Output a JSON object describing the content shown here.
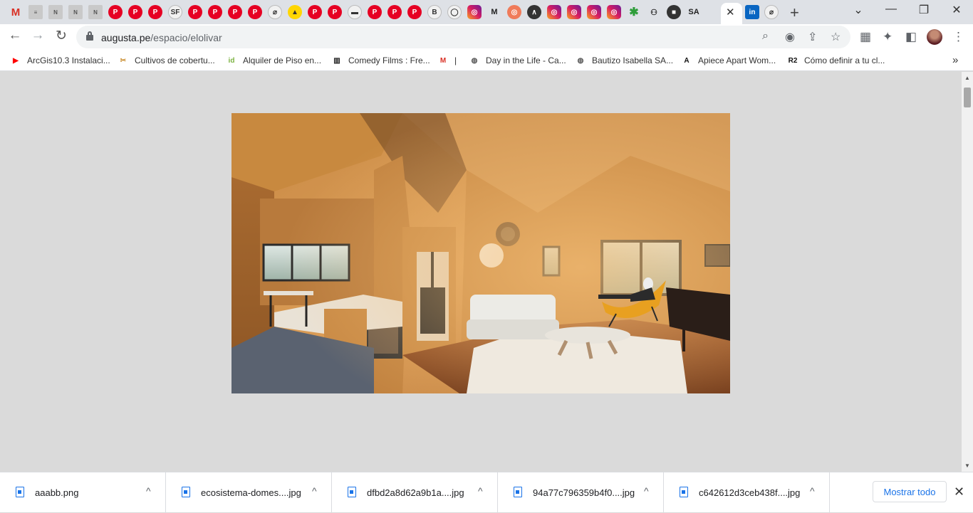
{
  "tabs": {
    "favicons": [
      {
        "name": "gmail-icon",
        "cls": "fav-gmail",
        "glyph": "M"
      },
      {
        "name": "doc-icon",
        "cls": "fav-doc",
        "glyph": "≡"
      },
      {
        "name": "nestle-icon",
        "cls": "fav-doc",
        "glyph": "N"
      },
      {
        "name": "nestle-icon",
        "cls": "fav-doc",
        "glyph": "N"
      },
      {
        "name": "nestle-icon",
        "cls": "fav-doc",
        "glyph": "N"
      },
      {
        "name": "pinterest-icon",
        "cls": "fav-pin",
        "glyph": "P"
      },
      {
        "name": "pinterest-icon",
        "cls": "fav-pin",
        "glyph": "P"
      },
      {
        "name": "pinterest-icon",
        "cls": "fav-pin",
        "glyph": "P"
      },
      {
        "name": "sf-icon",
        "cls": "fav-light",
        "glyph": "SF"
      },
      {
        "name": "pinterest-icon",
        "cls": "fav-pin",
        "glyph": "P"
      },
      {
        "name": "pinterest-icon",
        "cls": "fav-pin",
        "glyph": "P"
      },
      {
        "name": "pinterest-icon",
        "cls": "fav-pin",
        "glyph": "P"
      },
      {
        "name": "pinterest-icon",
        "cls": "fav-pin",
        "glyph": "P"
      },
      {
        "name": "clip-icon",
        "cls": "fav-light",
        "glyph": "⌀"
      },
      {
        "name": "yellow-app-icon",
        "cls": "fav-yellow",
        "glyph": "▲"
      },
      {
        "name": "pinterest-icon",
        "cls": "fav-pin",
        "glyph": "P"
      },
      {
        "name": "pinterest-icon",
        "cls": "fav-pin",
        "glyph": "P"
      },
      {
        "name": "film-icon",
        "cls": "fav-light",
        "glyph": "▬"
      },
      {
        "name": "pinterest-icon",
        "cls": "fav-pin",
        "glyph": "P"
      },
      {
        "name": "pinterest-icon",
        "cls": "fav-pin",
        "glyph": "P"
      },
      {
        "name": "pinterest-icon",
        "cls": "fav-pin",
        "glyph": "P"
      },
      {
        "name": "b-icon",
        "cls": "fav-light",
        "glyph": "B"
      },
      {
        "name": "circle-icon",
        "cls": "fav-light",
        "glyph": "◯"
      },
      {
        "name": "instagram-icon",
        "cls": "fav-ig",
        "glyph": "◎"
      },
      {
        "name": "medium-icon",
        "cls": "fav-text",
        "glyph": "M"
      },
      {
        "name": "target-icon",
        "cls": "fav-orange",
        "glyph": "◎"
      },
      {
        "name": "dark-app-icon",
        "cls": "fav-dark",
        "glyph": "∧"
      },
      {
        "name": "instagram-icon",
        "cls": "fav-ig",
        "glyph": "◎"
      },
      {
        "name": "instagram-icon",
        "cls": "fav-ig",
        "glyph": "◎"
      },
      {
        "name": "instagram-icon",
        "cls": "fav-ig",
        "glyph": "◎"
      },
      {
        "name": "instagram-icon",
        "cls": "fav-ig",
        "glyph": "◎"
      },
      {
        "name": "star-green-icon",
        "cls": "fav-green",
        "glyph": "✱"
      },
      {
        "name": "people-icon",
        "cls": "fav-text",
        "glyph": "⚇"
      },
      {
        "name": "cube-icon",
        "cls": "fav-dark",
        "glyph": "■"
      },
      {
        "name": "sa-icon",
        "cls": "fav-text",
        "glyph": "SA"
      }
    ],
    "after_active": [
      {
        "name": "linkedin-icon",
        "cls": "fav-li",
        "glyph": "in"
      },
      {
        "name": "clip-icon",
        "cls": "fav-light",
        "glyph": "⌀"
      }
    ],
    "close_glyph": "✕",
    "new_tab_glyph": "+"
  },
  "window": {
    "menu_glyph": "⌄",
    "minimize_glyph": "—",
    "restore_glyph": "❐",
    "close_glyph": "✕"
  },
  "toolbar": {
    "back_glyph": "←",
    "forward_glyph": "→",
    "reload_glyph": "↻",
    "url_host": "augusta.pe",
    "url_path": "/espacio/elolivar",
    "zoom_glyph": "⌕",
    "eye_glyph": "◉",
    "share_glyph": "⇪",
    "star_glyph": "☆",
    "grid_glyph": "▦",
    "ext_glyph": "✦",
    "panel_glyph": "◧",
    "more_glyph": "⋮"
  },
  "bookmarks": [
    {
      "label": "ArcGis10.3 Instalaci...",
      "icon": "▶",
      "color": "#ff0000",
      "name": "bookmark-arcgis",
      "icon_name": "youtube-icon"
    },
    {
      "label": "Cultivos de cobertu...",
      "icon": "✂",
      "color": "#c88a2a",
      "name": "bookmark-cultivos",
      "icon_name": "tools-icon"
    },
    {
      "label": "Alquiler de Piso en...",
      "icon": "id",
      "color": "#7cb342",
      "name": "bookmark-alquiler",
      "icon_name": "id-icon"
    },
    {
      "label": "Comedy Films : Fre...",
      "icon": "▥",
      "color": "#222222",
      "name": "bookmark-comedy",
      "icon_name": "archive-icon"
    },
    {
      "label": "|",
      "icon": "M",
      "color": "#d93025",
      "name": "bookmark-gmail",
      "icon_name": "gmail-icon"
    },
    {
      "label": "Day in the Life - Ca...",
      "icon": "◍",
      "color": "#555555",
      "name": "bookmark-day",
      "icon_name": "globe-icon"
    },
    {
      "label": "Bautizo Isabella SA...",
      "icon": "◍",
      "color": "#555555",
      "name": "bookmark-bautizo",
      "icon_name": "globe-icon"
    },
    {
      "label": "Apiece Apart Wom...",
      "icon": "A",
      "color": "#111111",
      "name": "bookmark-apiece",
      "icon_name": "a-icon"
    },
    {
      "label": "Cómo definir a tu cl...",
      "icon": "R2",
      "color": "#111111",
      "name": "bookmark-como",
      "icon_name": "r2-icon"
    }
  ],
  "bookmarks_more_glyph": "»",
  "downloads": {
    "items": [
      {
        "name": "aaabb.png"
      },
      {
        "name": "ecosistema-domes....jpg"
      },
      {
        "name": "dfbd2a8d62a9b1a....jpg"
      },
      {
        "name": "94a77c796359b4f0....jpg"
      },
      {
        "name": "c642612d3ceb438f....jpg"
      }
    ],
    "chevron_glyph": "^",
    "show_all": "Mostrar todo",
    "close_glyph": "✕"
  },
  "scrollbar": {
    "up_glyph": "▲",
    "down_glyph": "▼"
  }
}
